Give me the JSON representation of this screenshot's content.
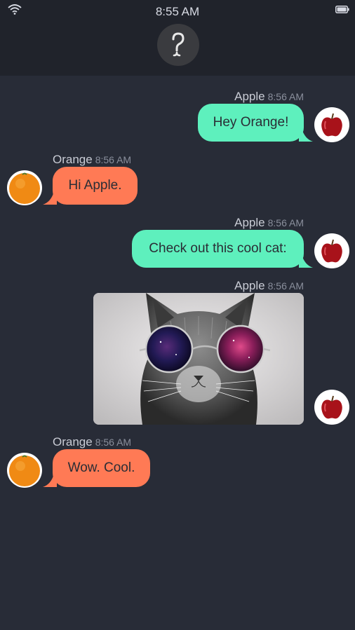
{
  "status_bar": {
    "time": "8:55 AM"
  },
  "header": {
    "avatar_icon": "question-mark-icon"
  },
  "messages": [
    {
      "sender": "Apple",
      "time": "8:56 AM",
      "text": "Hey Orange!"
    },
    {
      "sender": "Orange",
      "time": "8:56 AM",
      "text": "Hi Apple."
    },
    {
      "sender": "Apple",
      "time": "8:56 AM",
      "text": "Check out this cool cat:"
    },
    {
      "sender": "Apple",
      "time": "8:56 AM",
      "image": "cat-with-galaxy-sunglasses"
    },
    {
      "sender": "Orange",
      "time": "8:56 AM",
      "text": "Wow. Cool."
    }
  ],
  "colors": {
    "apple_bubble": "#5ef0bd",
    "orange_bubble": "#ff7a55",
    "background": "#282c37",
    "header": "#20232b"
  }
}
